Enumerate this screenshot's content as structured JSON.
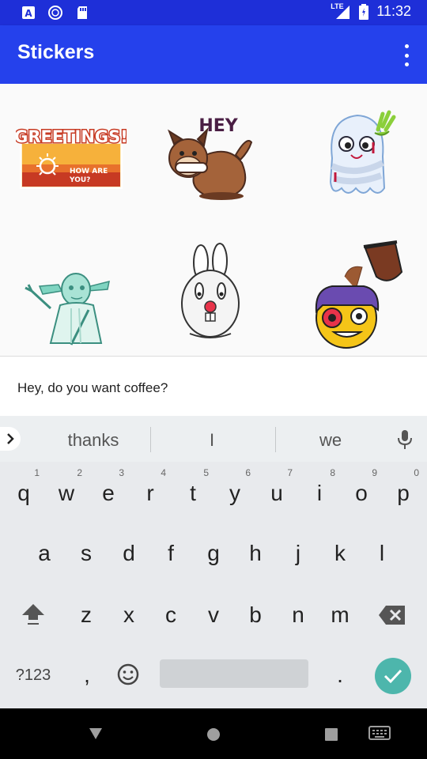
{
  "status_bar": {
    "time": "11:32",
    "network": "LTE",
    "icons": [
      "a-app-icon",
      "circle-app-icon",
      "sd-card-icon",
      "signal-icon",
      "battery-icon"
    ]
  },
  "app_bar": {
    "title": "Stickers",
    "menu_icon": "overflow-menu-icon"
  },
  "stickers": {
    "greetings": {
      "title": "GREETINGS!",
      "subtitle_line1": "HOW ARE",
      "subtitle_line2": "YOU?"
    },
    "dog": {
      "text": "HEY"
    },
    "ghost": {},
    "yoda": {},
    "bunny": {},
    "coffee_face": {}
  },
  "compose": {
    "text": "Hey, do you want coffee?"
  },
  "keyboard": {
    "suggestions": [
      "thanks",
      "I",
      "we"
    ],
    "row1": [
      {
        "k": "q",
        "h": "1"
      },
      {
        "k": "w",
        "h": "2"
      },
      {
        "k": "e",
        "h": "3"
      },
      {
        "k": "r",
        "h": "4"
      },
      {
        "k": "t",
        "h": "5"
      },
      {
        "k": "y",
        "h": "6"
      },
      {
        "k": "u",
        "h": "7"
      },
      {
        "k": "i",
        "h": "8"
      },
      {
        "k": "o",
        "h": "9"
      },
      {
        "k": "p",
        "h": "0"
      }
    ],
    "row2": [
      "a",
      "s",
      "d",
      "f",
      "g",
      "h",
      "j",
      "k",
      "l"
    ],
    "row3": [
      "z",
      "x",
      "c",
      "v",
      "b",
      "n",
      "m"
    ],
    "symbols_label": "?123",
    "comma": ",",
    "period": "."
  },
  "colors": {
    "status_bar": "#1e2fd8",
    "app_bar": "#2541ec",
    "enter_key": "#4db6ac"
  }
}
